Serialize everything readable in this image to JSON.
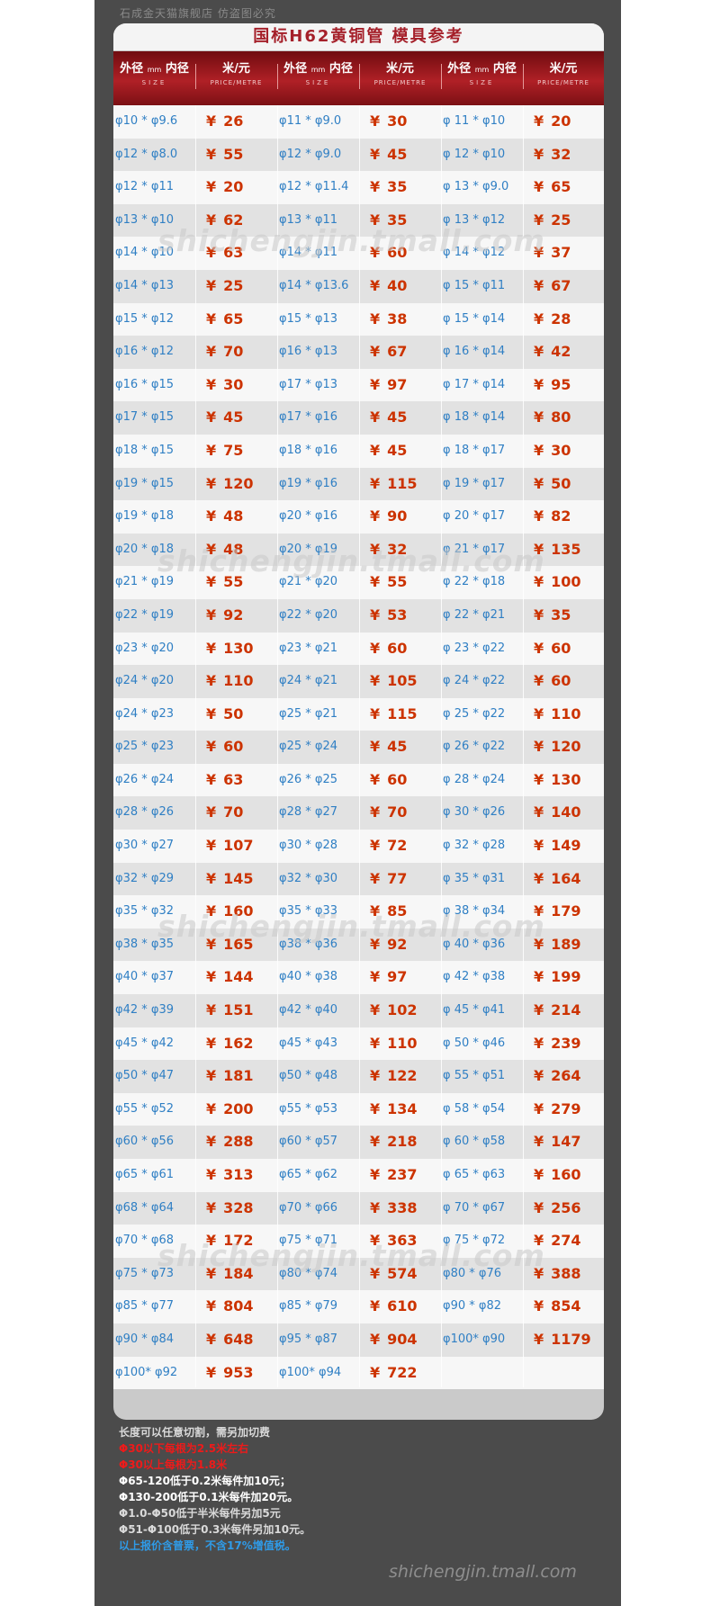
{
  "header": {
    "store_text": "石成金天猫旗舰店    仿盗图必究"
  },
  "title": "国标H62黄铜管  模具参考",
  "columns": {
    "size_label": "外径",
    "size_unit": "mm",
    "size_label2": "内径",
    "size_sub": "SIZE",
    "price_label": "米/元",
    "price_sub": "PRICE/METRE"
  },
  "currency_symbol": "¥",
  "table": {
    "rows": [
      [
        {
          "size": "φ10 * φ9.6",
          "price": "26"
        },
        {
          "size": "φ11 * φ9.0",
          "price": "30"
        },
        {
          "size": "φ 11 * φ10",
          "price": "20"
        }
      ],
      [
        {
          "size": "φ12 * φ8.0",
          "price": "55"
        },
        {
          "size": "φ12 * φ9.0",
          "price": "45"
        },
        {
          "size": "φ 12 * φ10",
          "price": "32"
        }
      ],
      [
        {
          "size": "φ12 * φ11",
          "price": "20"
        },
        {
          "size": "φ12 * φ11.4",
          "price": "35"
        },
        {
          "size": "φ 13 * φ9.0",
          "price": "65"
        }
      ],
      [
        {
          "size": "φ13 * φ10",
          "price": "62"
        },
        {
          "size": "φ13 * φ11",
          "price": "35"
        },
        {
          "size": "φ 13 * φ12",
          "price": "25"
        }
      ],
      [
        {
          "size": "φ14 * φ10",
          "price": "63"
        },
        {
          "size": "φ14 * φ11",
          "price": "60"
        },
        {
          "size": "φ 14 * φ12",
          "price": "37"
        }
      ],
      [
        {
          "size": "φ14 * φ13",
          "price": "25"
        },
        {
          "size": "φ14 * φ13.6",
          "price": "40"
        },
        {
          "size": "φ 15 * φ11",
          "price": "67"
        }
      ],
      [
        {
          "size": "φ15 * φ12",
          "price": "65"
        },
        {
          "size": "φ15 * φ13",
          "price": "38"
        },
        {
          "size": "φ 15 * φ14",
          "price": "28"
        }
      ],
      [
        {
          "size": "φ16 * φ12",
          "price": "70"
        },
        {
          "size": "φ16 * φ13",
          "price": "67"
        },
        {
          "size": "φ 16 * φ14",
          "price": "42"
        }
      ],
      [
        {
          "size": "φ16 * φ15",
          "price": "30"
        },
        {
          "size": "φ17 * φ13",
          "price": "97"
        },
        {
          "size": "φ 17 * φ14",
          "price": "95"
        }
      ],
      [
        {
          "size": "φ17 * φ15",
          "price": "45"
        },
        {
          "size": "φ17 * φ16",
          "price": "45"
        },
        {
          "size": "φ 18 * φ14",
          "price": "80"
        }
      ],
      [
        {
          "size": "φ18 * φ15",
          "price": "75"
        },
        {
          "size": "φ18 * φ16",
          "price": "45"
        },
        {
          "size": "φ 18 * φ17",
          "price": "30"
        }
      ],
      [
        {
          "size": "φ19 * φ15",
          "price": "120"
        },
        {
          "size": "φ19 * φ16",
          "price": "115"
        },
        {
          "size": "φ 19 * φ17",
          "price": "50"
        }
      ],
      [
        {
          "size": "φ19 * φ18",
          "price": "48"
        },
        {
          "size": "φ20 * φ16",
          "price": "90"
        },
        {
          "size": "φ 20 * φ17",
          "price": "82"
        }
      ],
      [
        {
          "size": "φ20 * φ18",
          "price": "48"
        },
        {
          "size": "φ20 * φ19",
          "price": "32"
        },
        {
          "size": "φ 21 * φ17",
          "price": "135"
        }
      ],
      [
        {
          "size": "φ21 * φ19",
          "price": "55"
        },
        {
          "size": "φ21 * φ20",
          "price": "55"
        },
        {
          "size": "φ 22 * φ18",
          "price": "100"
        }
      ],
      [
        {
          "size": "φ22 * φ19",
          "price": "92"
        },
        {
          "size": "φ22 * φ20",
          "price": "53"
        },
        {
          "size": "φ 22 * φ21",
          "price": "35"
        }
      ],
      [
        {
          "size": "φ23 * φ20",
          "price": "130"
        },
        {
          "size": "φ23 * φ21",
          "price": "60"
        },
        {
          "size": "φ 23 * φ22",
          "price": "60"
        }
      ],
      [
        {
          "size": "φ24 * φ20",
          "price": "110"
        },
        {
          "size": "φ24 * φ21",
          "price": "105"
        },
        {
          "size": "φ 24 * φ22",
          "price": "60"
        }
      ],
      [
        {
          "size": "φ24 * φ23",
          "price": "50"
        },
        {
          "size": "φ25 * φ21",
          "price": "115"
        },
        {
          "size": "φ 25 * φ22",
          "price": "110"
        }
      ],
      [
        {
          "size": "φ25 * φ23",
          "price": "60"
        },
        {
          "size": "φ25 * φ24",
          "price": "45"
        },
        {
          "size": "φ 26 * φ22",
          "price": "120"
        }
      ],
      [
        {
          "size": "φ26 * φ24",
          "price": "63"
        },
        {
          "size": "φ26 * φ25",
          "price": "60"
        },
        {
          "size": "φ 28 * φ24",
          "price": "130"
        }
      ],
      [
        {
          "size": "φ28 * φ26",
          "price": "70"
        },
        {
          "size": "φ28 * φ27",
          "price": "70"
        },
        {
          "size": "φ 30 * φ26",
          "price": "140"
        }
      ],
      [
        {
          "size": "φ30 * φ27",
          "price": "107"
        },
        {
          "size": "φ30 * φ28",
          "price": "72"
        },
        {
          "size": "φ 32 * φ28",
          "price": "149"
        }
      ],
      [
        {
          "size": "φ32 * φ29",
          "price": "145"
        },
        {
          "size": "φ32 * φ30",
          "price": "77"
        },
        {
          "size": "φ 35 * φ31",
          "price": "164"
        }
      ],
      [
        {
          "size": "φ35 * φ32",
          "price": "160"
        },
        {
          "size": "φ35 * φ33",
          "price": "85"
        },
        {
          "size": "φ 38 * φ34",
          "price": "179"
        }
      ],
      [
        {
          "size": "φ38 * φ35",
          "price": "165"
        },
        {
          "size": "φ38 * φ36",
          "price": "92"
        },
        {
          "size": "φ 40 * φ36",
          "price": "189"
        }
      ],
      [
        {
          "size": "φ40 * φ37",
          "price": "144"
        },
        {
          "size": "φ40 * φ38",
          "price": "97"
        },
        {
          "size": "φ 42 * φ38",
          "price": "199"
        }
      ],
      [
        {
          "size": "φ42 * φ39",
          "price": "151"
        },
        {
          "size": "φ42 * φ40",
          "price": "102"
        },
        {
          "size": "φ 45 * φ41",
          "price": "214"
        }
      ],
      [
        {
          "size": "φ45 * φ42",
          "price": "162"
        },
        {
          "size": "φ45 * φ43",
          "price": "110"
        },
        {
          "size": "φ 50 * φ46",
          "price": "239"
        }
      ],
      [
        {
          "size": "φ50 * φ47",
          "price": "181"
        },
        {
          "size": "φ50 * φ48",
          "price": "122"
        },
        {
          "size": "φ 55 * φ51",
          "price": "264"
        }
      ],
      [
        {
          "size": "φ55 * φ52",
          "price": "200"
        },
        {
          "size": "φ55 * φ53",
          "price": "134"
        },
        {
          "size": "φ 58 * φ54",
          "price": "279"
        }
      ],
      [
        {
          "size": "φ60 * φ56",
          "price": "288"
        },
        {
          "size": "φ60 * φ57",
          "price": "218"
        },
        {
          "size": "φ 60 * φ58",
          "price": "147"
        }
      ],
      [
        {
          "size": "φ65 * φ61",
          "price": "313"
        },
        {
          "size": "φ65 * φ62",
          "price": "237"
        },
        {
          "size": "φ 65 * φ63",
          "price": "160"
        }
      ],
      [
        {
          "size": "φ68 * φ64",
          "price": "328"
        },
        {
          "size": "φ70 * φ66",
          "price": "338"
        },
        {
          "size": "φ 70 * φ67",
          "price": "256"
        }
      ],
      [
        {
          "size": "φ70 * φ68",
          "price": "172"
        },
        {
          "size": "φ75 * φ71",
          "price": "363"
        },
        {
          "size": "φ 75 * φ72",
          "price": "274"
        }
      ],
      [
        {
          "size": "φ75 * φ73",
          "price": "184"
        },
        {
          "size": "φ80 * φ74",
          "price": "574"
        },
        {
          "size": "φ80 * φ76",
          "price": "388"
        }
      ],
      [
        {
          "size": "φ85 * φ77",
          "price": "804"
        },
        {
          "size": "φ85 * φ79",
          "price": "610"
        },
        {
          "size": "φ90 * φ82",
          "price": "854"
        }
      ],
      [
        {
          "size": "φ90 * φ84",
          "price": "648"
        },
        {
          "size": "φ95 * φ87",
          "price": "904"
        },
        {
          "size": "φ100* φ90",
          "price": "1179"
        }
      ],
      [
        {
          "size": "φ100* φ92",
          "price": "953"
        },
        {
          "size": "φ100* φ94",
          "price": "722"
        },
        {
          "size": "",
          "price": ""
        }
      ]
    ]
  },
  "watermark": "shichengjin.tmall.com",
  "notes": [
    {
      "text": "长度可以任意切割，需另加切费",
      "color": "#d9d9d9"
    },
    {
      "text": "Φ30以下每根为2.5米左右",
      "color": "#ee1a1a"
    },
    {
      "text": "Φ30以上每根为1.8米",
      "color": "#ee1a1a"
    },
    {
      "text": "Φ65-120低于0.2米每件加10元；",
      "color": "#ffffff"
    },
    {
      "text": "Φ130-200低于0.1米每件加20元。",
      "color": "#ffffff"
    },
    {
      "text": "Φ1.0-Φ50低于半米每件另加5元",
      "color": "#d9d9d9"
    },
    {
      "text": "Φ51-Φ100低于0.3米每件另加10元。",
      "color": "#d9d9d9"
    },
    {
      "text": "以上报价含普票，不含17%增值税。",
      "color": "#2f9be8"
    }
  ],
  "footer_watermark": "shichengjin.tmall.com"
}
